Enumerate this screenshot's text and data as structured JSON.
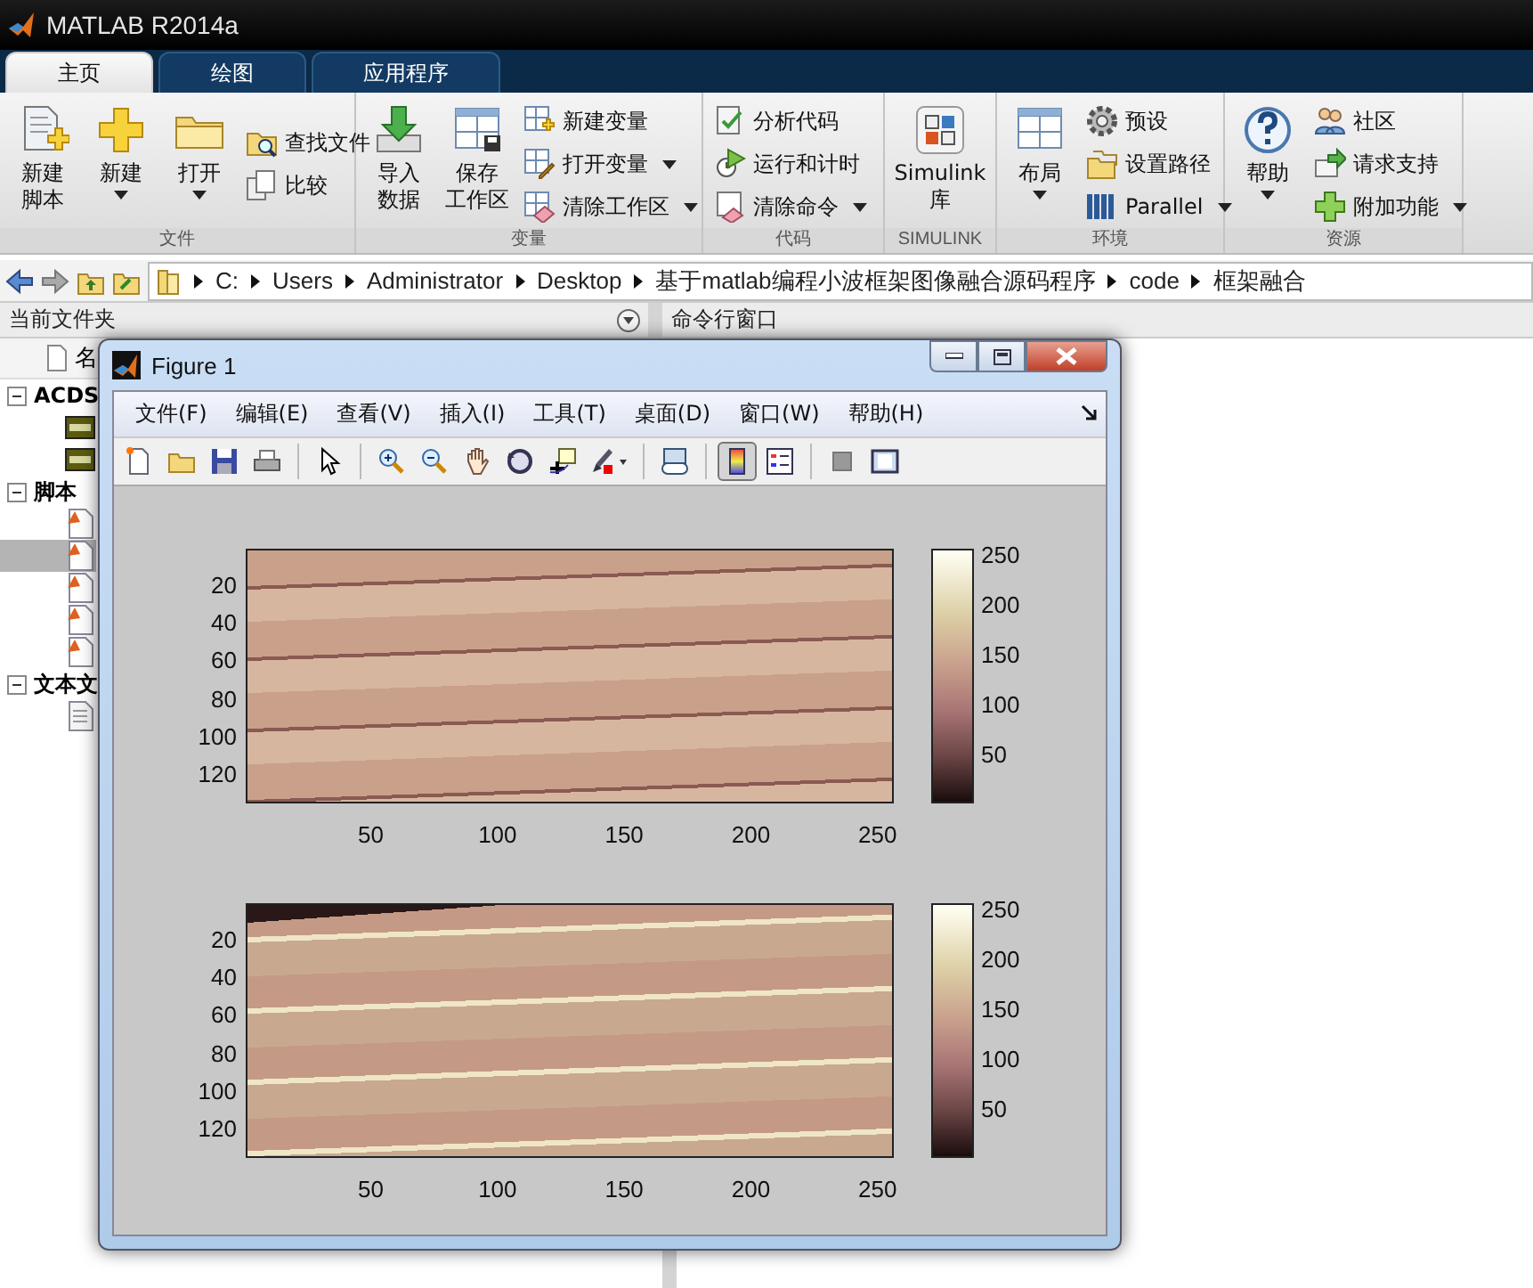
{
  "window": {
    "title": "MATLAB R2014a"
  },
  "tabs": [
    {
      "label": "主页",
      "selected": true
    },
    {
      "label": "绘图",
      "selected": false
    },
    {
      "label": "应用程序",
      "selected": false
    }
  ],
  "toolstrip": [
    {
      "label": "文件",
      "items": [
        {
          "kind": "large",
          "lines": [
            "新建",
            "脚本"
          ],
          "dropdown": false
        },
        {
          "kind": "large",
          "lines": [
            "新建"
          ],
          "dropdown": true
        },
        {
          "kind": "large",
          "lines": [
            "打开"
          ],
          "dropdown": true
        },
        {
          "kind": "small",
          "label": "查找文件",
          "dropdown": false
        },
        {
          "kind": "small",
          "label": "比较",
          "dropdown": false
        }
      ]
    },
    {
      "label": "变量",
      "items": [
        {
          "kind": "large",
          "lines": [
            "导入",
            "数据"
          ],
          "dropdown": false
        },
        {
          "kind": "large",
          "lines": [
            "保存",
            "工作区"
          ],
          "dropdown": false
        },
        {
          "kind": "small",
          "label": "新建变量",
          "dropdown": false
        },
        {
          "kind": "small",
          "label": "打开变量",
          "dropdown": true
        },
        {
          "kind": "small",
          "label": "清除工作区",
          "dropdown": true
        }
      ]
    },
    {
      "label": "代码",
      "items": [
        {
          "kind": "small",
          "label": "分析代码",
          "dropdown": false
        },
        {
          "kind": "small",
          "label": "运行和计时",
          "dropdown": false
        },
        {
          "kind": "small",
          "label": "清除命令",
          "dropdown": true
        }
      ]
    },
    {
      "label": "SIMULINK",
      "items": [
        {
          "kind": "large",
          "lines": [
            "Simulink",
            "库"
          ],
          "dropdown": false
        }
      ]
    },
    {
      "label": "环境",
      "items": [
        {
          "kind": "large",
          "lines": [
            "布局"
          ],
          "dropdown": true
        },
        {
          "kind": "small",
          "label": "预设",
          "dropdown": false
        },
        {
          "kind": "small",
          "label": "设置路径",
          "dropdown": false
        },
        {
          "kind": "small",
          "label": "Parallel",
          "dropdown": true
        }
      ]
    },
    {
      "label": "资源",
      "items": [
        {
          "kind": "large",
          "lines": [
            "帮助"
          ],
          "dropdown": true
        },
        {
          "kind": "small",
          "label": "社区",
          "dropdown": false
        },
        {
          "kind": "small",
          "label": "请求支持",
          "dropdown": false
        },
        {
          "kind": "small",
          "label": "附加功能",
          "dropdown": true
        }
      ]
    }
  ],
  "address_bar": {
    "path": [
      "C:",
      "Users",
      "Administrator",
      "Desktop",
      "基于matlab编程小波框架图像融合源码程序",
      "code",
      "框架融合"
    ]
  },
  "current_folder": {
    "title": "当前文件夹",
    "column_header": "名",
    "groups": [
      {
        "label": "ACDS",
        "expanded": true,
        "children": [
          {
            "kind": "jpg",
            "selected": false
          },
          {
            "kind": "jpg",
            "selected": false
          }
        ]
      },
      {
        "label": "脚本",
        "expanded": true,
        "children": [
          {
            "kind": "script",
            "selected": false
          },
          {
            "kind": "script",
            "selected": true
          },
          {
            "kind": "script",
            "selected": false
          },
          {
            "kind": "script",
            "selected": false
          },
          {
            "kind": "script",
            "selected": false
          }
        ]
      },
      {
        "label": "文本文",
        "expanded": true,
        "children": [
          {
            "kind": "text",
            "selected": false
          }
        ]
      }
    ]
  },
  "command_window": {
    "title": "命令行窗口"
  },
  "figure": {
    "title": "Figure 1",
    "menus": [
      "文件(F)",
      "编辑(E)",
      "查看(V)",
      "插入(I)",
      "工具(T)",
      "桌面(D)",
      "窗口(W)",
      "帮助(H)"
    ],
    "toolbar": [
      {
        "kind": "button",
        "selected": false
      },
      {
        "kind": "button",
        "selected": false
      },
      {
        "kind": "button",
        "selected": false
      },
      {
        "kind": "button",
        "selected": false
      },
      {
        "kind": "separator"
      },
      {
        "kind": "button",
        "selected": false
      },
      {
        "kind": "separator"
      },
      {
        "kind": "button",
        "selected": false
      },
      {
        "kind": "button",
        "selected": false
      },
      {
        "kind": "button",
        "selected": false
      },
      {
        "kind": "button",
        "selected": false
      },
      {
        "kind": "button",
        "selected": false
      },
      {
        "kind": "button",
        "selected": false
      },
      {
        "kind": "separator"
      },
      {
        "kind": "button",
        "selected": false
      },
      {
        "kind": "separator"
      },
      {
        "kind": "button",
        "selected": true
      },
      {
        "kind": "button",
        "selected": false
      },
      {
        "kind": "separator"
      },
      {
        "kind": "button",
        "selected": false
      },
      {
        "kind": "button",
        "selected": false
      }
    ],
    "plots": [
      {
        "kind": "original",
        "yticks": [
          "20",
          "40",
          "60",
          "80",
          "100",
          "120"
        ],
        "xticks": [
          "50",
          "100",
          "150",
          "200",
          "250"
        ],
        "colorbar_ticks": [
          "250",
          "200",
          "150",
          "100",
          "50"
        ]
      },
      {
        "kind": "rotated",
        "yticks": [
          "20",
          "40",
          "60",
          "80",
          "100",
          "120"
        ],
        "xticks": [
          "50",
          "100",
          "150",
          "200",
          "250"
        ],
        "colorbar_ticks": [
          "250",
          "200",
          "150",
          "100",
          "50"
        ]
      }
    ]
  }
}
